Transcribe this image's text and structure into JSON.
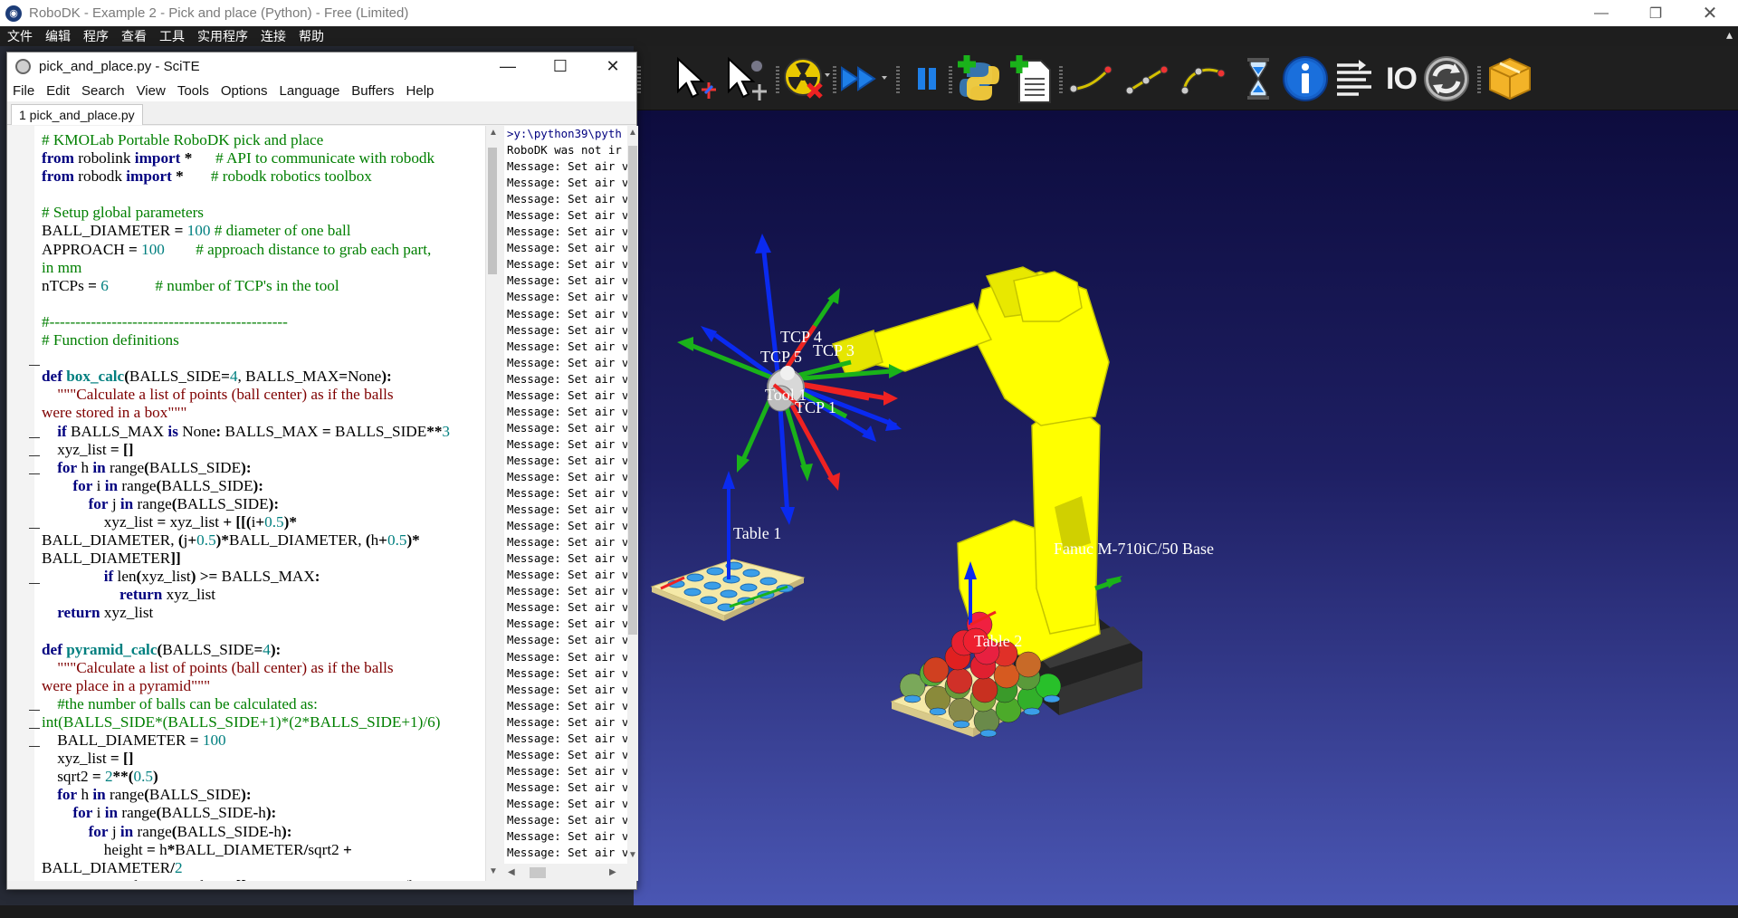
{
  "robodk": {
    "title": "RoboDK - Example 2 - Pick and place (Python) - Free (Limited)",
    "app_icon": "robodk-logo-icon",
    "menu": [
      "文件",
      "编辑",
      "程序",
      "查看",
      "工具",
      "实用程序",
      "连接",
      "帮助"
    ],
    "toolbar": {
      "io_label": "IO",
      "icons": [
        "select-rotate-icon",
        "select-pan-icon",
        "radiation-stop-icon",
        "fast-forward-icon",
        "pause-icon",
        "add-python-program-icon",
        "add-program-icon",
        "move-joint-icon",
        "move-linear-icon",
        "move-circular-icon",
        "pause-hourglass-icon",
        "info-icon",
        "set-reference-icon",
        "io-icon",
        "refresh-icon",
        "box-icon"
      ]
    },
    "scene": {
      "labels": {
        "tcp4": "TCP 4",
        "tcp5": "TCP 5",
        "tcp3": "TCP 3",
        "tcp1": "TCP 1",
        "tool_frame": "Tool 1",
        "table1": "Table 1",
        "table2": "Table 2",
        "robot_base": "Fanuc M-710iC/50 Base"
      },
      "colors": {
        "robot": "#ffff00",
        "ball_red": "#e02020",
        "ball_green": "#4caa2a",
        "ball_blue": "#3a9ee8",
        "table": "#f5e9a8"
      }
    }
  },
  "scite": {
    "title": "pick_and_place.py - SciTE",
    "menu": [
      "File",
      "Edit",
      "Search",
      "View",
      "Tools",
      "Options",
      "Language",
      "Buffers",
      "Help"
    ],
    "tab": "1 pick_and_place.py",
    "output_first": ">y:\\python39\\pyth",
    "output_second": "RoboDK was not ir",
    "output_message": "Message: Set air v",
    "output_message_count": 44
  }
}
